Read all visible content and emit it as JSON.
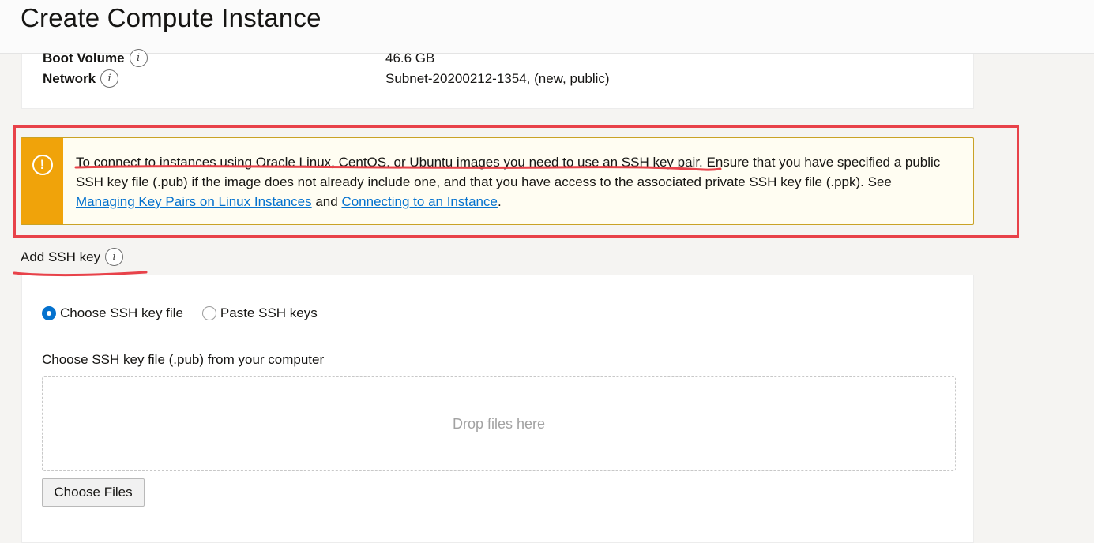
{
  "header": {
    "title": "Create Compute Instance"
  },
  "summary": {
    "rows": [
      {
        "label": "Boot Volume",
        "value": "46.6 GB"
      },
      {
        "label": "Network",
        "value": "Subnet-20200212-1354, (new, public)"
      }
    ]
  },
  "warning": {
    "text_main": "To connect to instances using Oracle Linux, CentOS, or Ubuntu images you need to use an SSH key pair. Ensure that you have specified a public SSH key file (.pub) if the image does not already include one, and that you have access to the associated private SSH key file (.ppk). See ",
    "link1": "Managing Key Pairs on Linux Instances",
    "and": " and ",
    "link2": "Connecting to an Instance",
    "end": "."
  },
  "ssh": {
    "section_label": "Add SSH key",
    "option_file": "Choose SSH key file",
    "option_paste": "Paste SSH keys",
    "file_label": "Choose SSH key file (.pub) from your computer",
    "drop_text": "Drop files here",
    "choose_button": "Choose Files"
  },
  "colors": {
    "accent": "#0572ce",
    "warning": "#f0a30a",
    "annotation": "#e8424a"
  }
}
